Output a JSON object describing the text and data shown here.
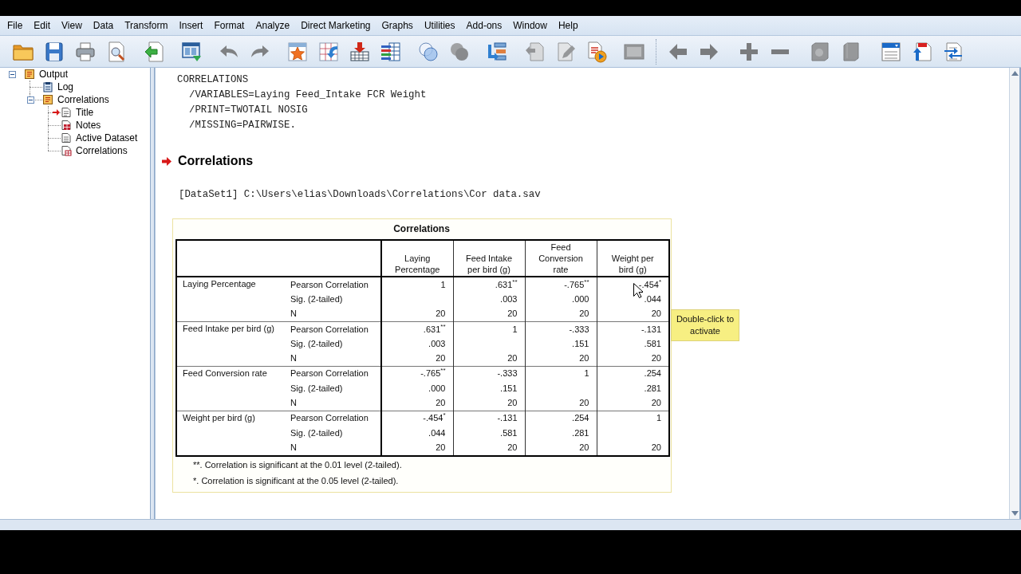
{
  "menu": [
    "File",
    "Edit",
    "View",
    "Data",
    "Transform",
    "Insert",
    "Format",
    "Analyze",
    "Direct Marketing",
    "Graphs",
    "Utilities",
    "Add-ons",
    "Window",
    "Help"
  ],
  "toolbar": [
    {
      "groups": [
        [
          {
            "disabled": false
          },
          {
            "disabled": false
          },
          {
            "disabled": false
          },
          {
            "disabled": false
          }
        ],
        [
          {
            "disabled": false
          }
        ],
        [
          {
            "disabled": false
          }
        ],
        [
          {
            "disabled": true
          },
          {
            "disabled": true
          }
        ],
        [
          {
            "disabled": false
          },
          {
            "disabled": false
          },
          {
            "disabled": false
          },
          {
            "disabled": false
          }
        ],
        [
          {
            "disabled": false
          },
          {
            "disabled": true
          }
        ],
        [
          {
            "disabled": false
          }
        ],
        [
          {
            "disabled": true
          },
          {
            "disabled": true
          },
          {
            "disabled": false
          }
        ],
        [
          {
            "disabled": true
          }
        ]
      ]
    },
    {
      "groups": [
        [
          {
            "disabled": true
          },
          {
            "disabled": true
          }
        ],
        [
          {
            "disabled": true
          },
          {
            "disabled": true
          }
        ],
        [
          {
            "disabled": true
          },
          {
            "disabled": true
          }
        ],
        [
          {
            "disabled": false
          },
          {
            "disabled": false
          },
          {
            "disabled": false
          }
        ]
      ]
    }
  ],
  "outline": [
    {
      "label": "Output",
      "kind": "heading",
      "expanded": true,
      "selected": false,
      "children": [
        {
          "label": "Log",
          "kind": "log",
          "selected": false
        },
        {
          "label": "Correlations",
          "kind": "heading",
          "expanded": true,
          "selected": false,
          "children": [
            {
              "label": "Title",
              "kind": "title",
              "selected": true
            },
            {
              "label": "Notes",
              "kind": "notes",
              "selected": false
            },
            {
              "label": "Active Dataset",
              "kind": "text",
              "selected": false
            },
            {
              "label": "Correlations",
              "kind": "table",
              "selected": false
            }
          ]
        }
      ]
    }
  ],
  "syntax": {
    "command": "CORRELATIONS",
    "subcommands": [
      "/VARIABLES=Laying Feed_Intake FCR Weight",
      "/PRINT=TWOTAIL NOSIG",
      "/MISSING=PAIRWISE."
    ]
  },
  "heading": "Correlations",
  "dataset_line": "[DataSet1] C:\\Users\\elias\\Downloads\\Correlations\\Cor data.sav",
  "pivot_table": {
    "title": "Correlations",
    "columns": [
      "Laying Percentage",
      "Feed Intake per bird (g)",
      "Feed Conversion rate",
      "Weight per bird (g)"
    ],
    "rows": [
      {
        "variable": "Laying Percentage",
        "stats": [
          {
            "label": "Pearson Correlation",
            "values": [
              "1",
              ".631$^{**}$",
              "-.765$^{**}$",
              "-.454$^{*}$"
            ]
          },
          {
            "label": "Sig. (2-tailed)",
            "values": [
              ".003",
              ".000",
              ".044"
            ]
          },
          {
            "label": "N",
            "values": [
              "20",
              "20",
              "20",
              "20"
            ]
          }
        ]
      },
      {
        "variable": "Feed Intake per bird (g)",
        "stats": [
          {
            "label": "Pearson Correlation",
            "values": [
              ".631$^{**}$",
              "1",
              "-.333",
              "-.131"
            ]
          },
          {
            "label": "Sig. (2-tailed)",
            "values": [
              ".003",
              ".151",
              ".581"
            ]
          },
          {
            "label": "N",
            "values": [
              "20",
              "20",
              "20",
              "20"
            ]
          }
        ]
      },
      {
        "variable": "Feed Conversion rate",
        "stats": [
          {
            "label": "Pearson Correlation",
            "values": [
              "-.765$^{**}$",
              "-.333",
              "1",
              ".254"
            ]
          },
          {
            "label": "Sig. (2-tailed)",
            "values": [
              ".000",
              ".151",
              ".281"
            ]
          },
          {
            "label": "N",
            "values": [
              "20",
              "20",
              "20",
              "20"
            ]
          }
        ]
      },
      {
        "variable": "Weight per bird (g)",
        "stats": [
          {
            "label": "Pearson Correlation",
            "values": [
              "-.454$^{*}$",
              "-.131",
              ".254",
              "1"
            ]
          },
          {
            "label": "Sig. (2-tailed)",
            "values": [
              ".044",
              ".581",
              ".281"
            ]
          },
          {
            "label": "N",
            "values": [
              "20",
              "20",
              "20",
              "20"
            ]
          }
        ]
      }
    ],
    "footnotes": [
      "**. Correlation is significant at the 0.01 level (2-tailed).",
      "*. Correlation is significant at the 0.05 level (2-tailed)."
    ]
  },
  "tooltip": {
    "text": "Double-click to activate"
  }
}
